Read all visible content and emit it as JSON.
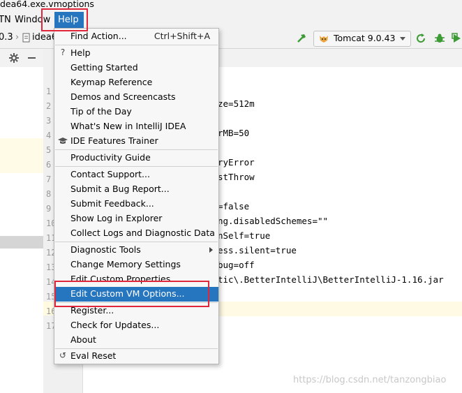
{
  "window": {
    "title": "dea64.exe.vmoptions"
  },
  "menubar": {
    "items": [
      "TN",
      "Window",
      "Help"
    ]
  },
  "toolbar": {
    "crumb_version": "0.3",
    "crumb_file": "idea6",
    "run_config": "Tomcat 9.0.43"
  },
  "gutter": {
    "line_numbers": [
      "1",
      "2",
      "3",
      "4",
      "5",
      "6",
      "7",
      "8",
      "9",
      "10",
      "11",
      "12",
      "13",
      "14",
      "15",
      "16",
      "17"
    ]
  },
  "editor": {
    "lines": [
      "ze=512m",
      "rMB=50",
      "ryError",
      "stThrow",
      "=false",
      "ng.disabledSchemes=\"\"",
      "nSelf=true",
      "ess.silent=true",
      "bug=off",
      "tic\\.BetterIntelliJ\\BetterIntelliJ-1.16.jar"
    ]
  },
  "help_menu": {
    "find_action": {
      "label": "Find Action...",
      "shortcut": "Ctrl+Shift+A"
    },
    "help": "Help",
    "getting_started": "Getting Started",
    "keymap_reference": "Keymap Reference",
    "demos": "Demos and Screencasts",
    "tip_of_day": "Tip of the Day",
    "whats_new": "What's New in IntelliJ IDEA",
    "ide_features_trainer": "IDE Features Trainer",
    "productivity_guide": "Productivity Guide",
    "contact_support": "Contact Support...",
    "submit_bug": "Submit a Bug Report...",
    "submit_feedback": "Submit Feedback...",
    "show_log": "Show Log in Explorer",
    "collect_logs": "Collect Logs and Diagnostic Data",
    "diagnostic_tools": "Diagnostic Tools",
    "change_memory": "Change Memory Settings",
    "edit_custom_properties": "Edit Custom Properties...",
    "edit_custom_vm": "Edit Custom VM Options...",
    "register": "Register...",
    "check_updates": "Check for Updates...",
    "about": "About",
    "eval_reset": "Eval Reset"
  },
  "watermark": "https://blog.csdn.net/tanzongbiao",
  "colors": {
    "menu_highlight": "#2675bf",
    "annotation_red": "#e0263a",
    "run_green": "#3d9b35"
  }
}
